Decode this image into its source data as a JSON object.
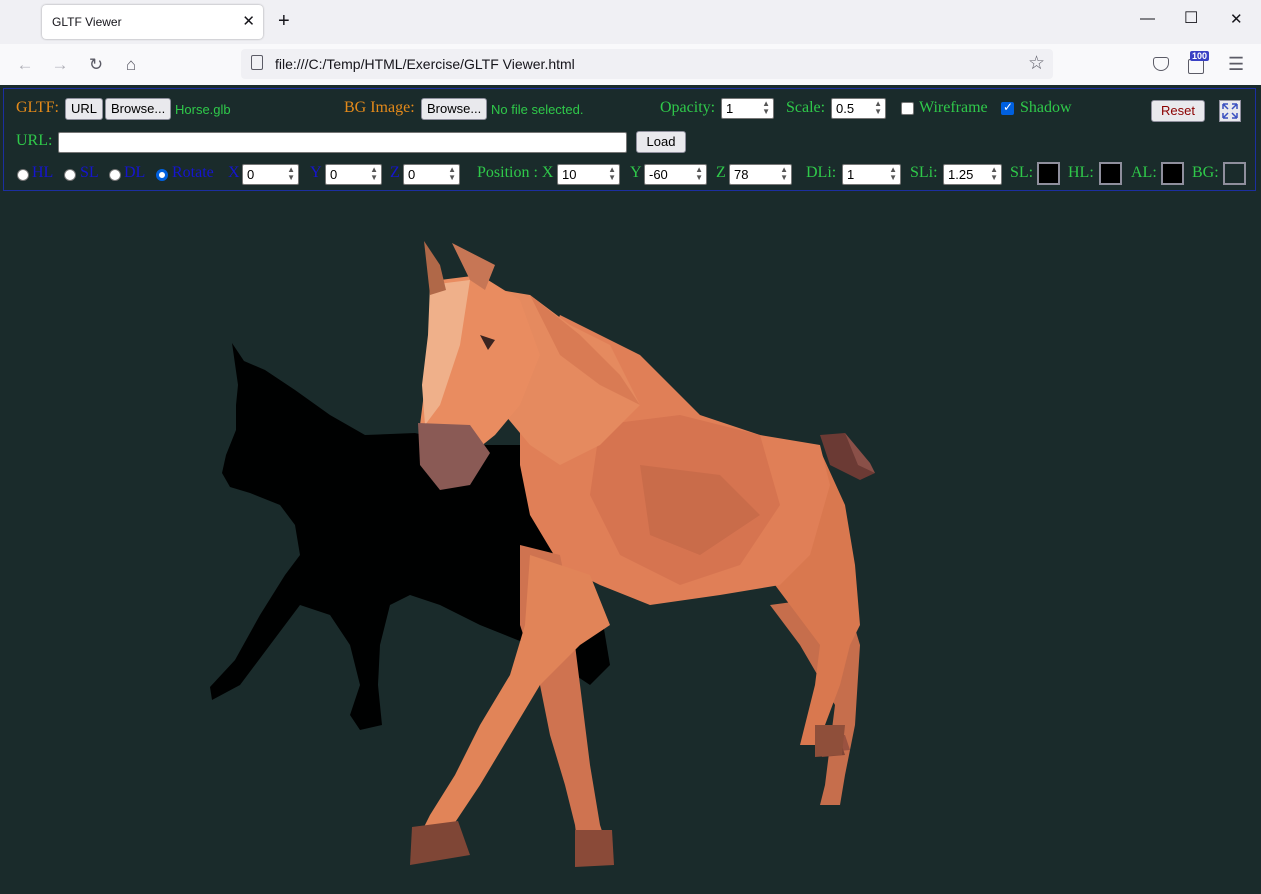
{
  "browser": {
    "tab_title": "GLTF Viewer",
    "url": "file:///C:/Temp/HTML/Exercise/GLTF Viewer.html",
    "extension_badge": "100"
  },
  "controls": {
    "gltf_label": "GLTF:",
    "url_button": "URL",
    "browse_button": "Browse...",
    "gltf_file": "Horse.glb",
    "bg_image_label": "BG Image:",
    "bg_browse_button": "Browse...",
    "bg_file": "No file selected.",
    "opacity_label": "Opacity:",
    "opacity_value": "1",
    "scale_label": "Scale:",
    "scale_value": "0.5",
    "wireframe_label": "Wireframe",
    "wireframe_checked": false,
    "shadow_label": "Shadow",
    "shadow_checked": true,
    "reset_button": "Reset",
    "url_label": "URL:",
    "url_value": "",
    "load_button": "Load",
    "radios": [
      {
        "label": "HL",
        "checked": false
      },
      {
        "label": "SL",
        "checked": false
      },
      {
        "label": "DL",
        "checked": false
      },
      {
        "label": "Rotate",
        "checked": true
      }
    ],
    "x_label": "X",
    "x_value": "0",
    "y_label": "Y",
    "y_value": "0",
    "z_label": "Z",
    "z_value": "0",
    "position_label": "Position : X",
    "pos_x_value": "10",
    "pos_y_label": "Y",
    "pos_y_value": "-60",
    "pos_z_label": "Z",
    "pos_z_value": "78",
    "dli_label": "DLi:",
    "dli_value": "1",
    "sli_label": "SLi:",
    "sli_value": "1.25",
    "sl_label": "SL:",
    "hl_label": "HL:",
    "al_label": "AL:",
    "bg_label": "BG:",
    "colors": {
      "sl": "#000000",
      "hl": "#000000",
      "al": "#000000",
      "bg": "#1a2b2b",
      "label_orange": "#e48a1a",
      "label_green": "#2fc94a",
      "label_blue": "#1515d0",
      "horse": "#e0825a",
      "shadow": "#000000"
    }
  }
}
